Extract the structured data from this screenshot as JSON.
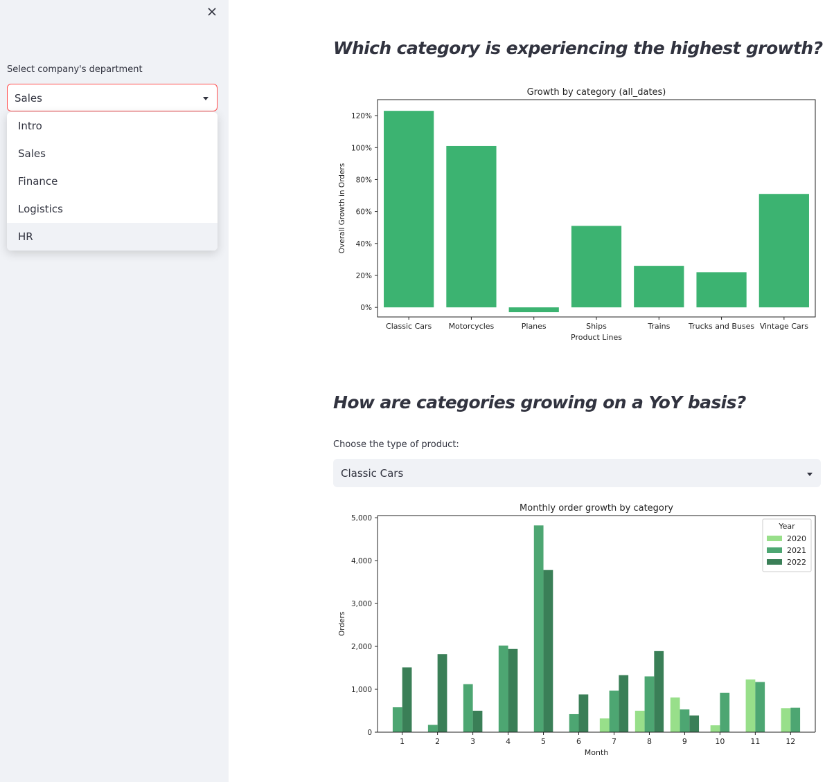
{
  "sidebar": {
    "close_icon": "close-icon",
    "department_label": "Select company's department",
    "department_selected": "Sales",
    "department_options": [
      "Intro",
      "Sales",
      "Finance",
      "Logistics",
      "HR"
    ],
    "highlighted_option": "HR"
  },
  "main": {
    "heading_growth": "Which category is experiencing the highest growth?",
    "heading_yoy": "How are categories growing on a YoY basis?",
    "product_label": "Choose the type of product:",
    "product_selected": "Classic Cars"
  },
  "chart_data": [
    {
      "type": "bar",
      "title": "Growth by category (all_dates)",
      "xlabel": "Product Lines",
      "ylabel": "Overall Growth in Orders",
      "categories": [
        "Classic Cars",
        "Motorcycles",
        "Planes",
        "Ships",
        "Trains",
        "Trucks and Buses",
        "Vintage Cars"
      ],
      "values": [
        123,
        101,
        -3,
        51,
        26,
        22,
        71
      ],
      "yticks": [
        "0%",
        "20%",
        "40%",
        "60%",
        "80%",
        "100%",
        "120%"
      ],
      "ylim": [
        -6,
        130
      ],
      "color": "#3cb371"
    },
    {
      "type": "bar",
      "title": "Monthly order growth by category",
      "xlabel": "Month",
      "ylabel": "Orders",
      "categories": [
        "1",
        "2",
        "3",
        "4",
        "5",
        "6",
        "7",
        "8",
        "9",
        "10",
        "11",
        "12"
      ],
      "legend_title": "Year",
      "legend_position": "top-right",
      "yticks": [
        "0",
        "1,000",
        "2,000",
        "3,000",
        "4,000",
        "5,000"
      ],
      "ylim": [
        0,
        5050
      ],
      "series": [
        {
          "name": "2020",
          "color": "#98df8a",
          "values": [
            null,
            null,
            null,
            null,
            null,
            null,
            320,
            500,
            810,
            160,
            1230,
            560
          ]
        },
        {
          "name": "2021",
          "color": "#4da672",
          "values": [
            580,
            170,
            1120,
            2020,
            4820,
            420,
            970,
            1300,
            530,
            920,
            1170,
            570
          ]
        },
        {
          "name": "2022",
          "color": "#3a7f57",
          "values": [
            1510,
            1820,
            500,
            1940,
            3780,
            880,
            1330,
            1890,
            390,
            null,
            null,
            null
          ]
        }
      ]
    }
  ]
}
